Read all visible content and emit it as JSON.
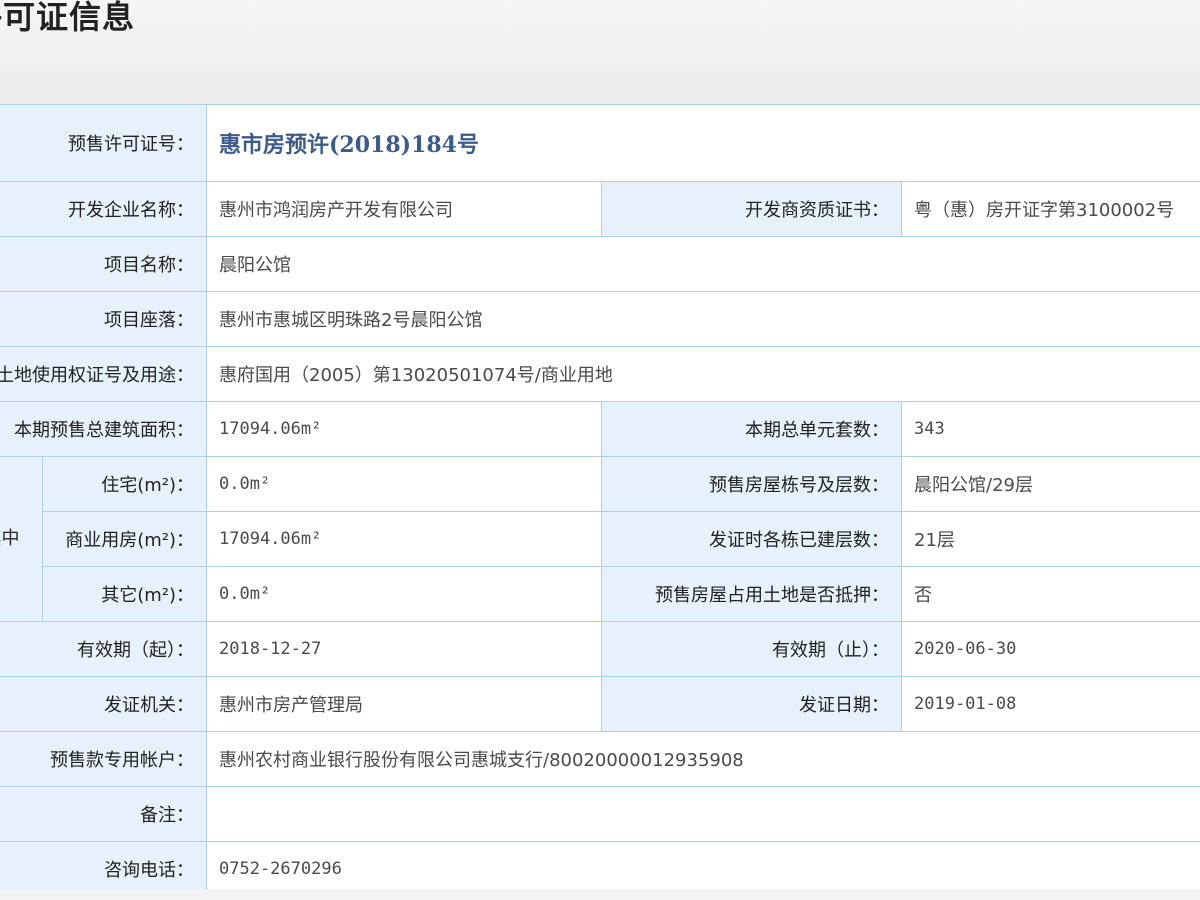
{
  "page": {
    "title": "许可证信息"
  },
  "table": {
    "rows": {
      "cert_no": {
        "label": "预售许可证号：",
        "value": "惠市房预许(2018)184号"
      },
      "developer": {
        "label": "开发企业名称：",
        "value": "惠州市鸿润房产开发有限公司",
        "qual_label": "开发商资质证书：",
        "qual_value": "粤（惠）房开证字第3100002号"
      },
      "project_name": {
        "label": "项目名称：",
        "value": "晨阳公馆"
      },
      "project_location": {
        "label": "项目座落：",
        "value": "惠州市惠城区明珠路2号晨阳公馆"
      },
      "land_cert": {
        "label": "土地使用权证号及用途：",
        "value": "惠府国用（2005）第13020501074号/商业用地"
      },
      "total_area": {
        "label": "本期预售总建筑面积：",
        "value": "17094.06m²",
        "units_label": "本期总单元套数：",
        "units_value": "343"
      },
      "side_label": "其中",
      "residential": {
        "label": "住宅(m²)：",
        "value": "0.0m²",
        "building_label": "预售房屋栋号及层数：",
        "building_value": "晨阳公馆/29层"
      },
      "commercial": {
        "label": "商业用房(m²)：",
        "value": "17094.06m²",
        "floors_label": "发证时各栋已建层数：",
        "floors_value": "21层"
      },
      "other": {
        "label": "其它(m²)：",
        "value": "0.0m²",
        "mortgage_label": "预售房屋占用土地是否抵押：",
        "mortgage_value": "否"
      },
      "validity": {
        "start_label": "有效期（起）：",
        "start_value": "2018-12-27",
        "end_label": "有效期（止）：",
        "end_value": "2020-06-30"
      },
      "issuer": {
        "label": "发证机关：",
        "value": "惠州市房产管理局",
        "date_label": "发证日期：",
        "date_value": "2019-01-08"
      },
      "account": {
        "label": "预售款专用帐户：",
        "value": "惠州农村商业银行股份有限公司惠城支行/80020000012935908"
      },
      "remarks": {
        "label": "备注：",
        "value": ""
      },
      "phone": {
        "label": "咨询电话：",
        "value": "0752-2670296"
      }
    }
  },
  "colors": {
    "label_bg": "#e6f1fb",
    "border": "#aecfe6",
    "cert_text": "#3c5a8a"
  }
}
